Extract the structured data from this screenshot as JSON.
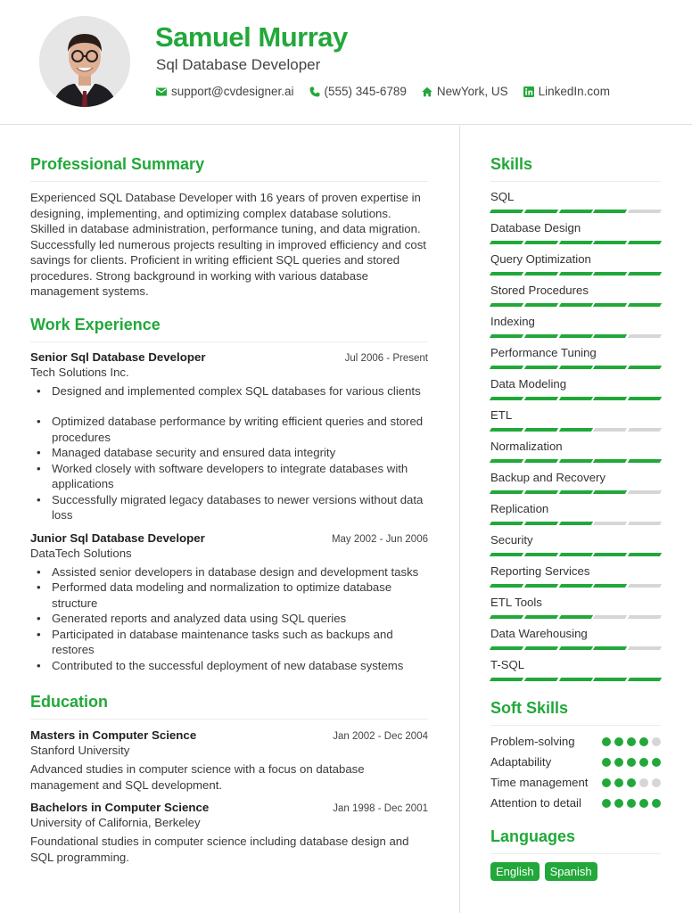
{
  "header": {
    "name": "Samuel Murray",
    "title": "Sql Database Developer",
    "contacts": [
      {
        "icon": "envelope-icon",
        "text": "support@cvdesigner.ai"
      },
      {
        "icon": "phone-icon",
        "text": "(555) 345-6789"
      },
      {
        "icon": "home-icon",
        "text": "NewYork, US"
      },
      {
        "icon": "linkedin-icon",
        "text": "LinkedIn.com"
      }
    ]
  },
  "colors": {
    "accent": "#22a83a",
    "inactive": "#d6d6d6"
  },
  "summary": {
    "heading": "Professional Summary",
    "text": "Experienced SQL Database Developer with 16 years of proven expertise in designing, implementing, and optimizing complex database solutions. Skilled in database administration, performance tuning, and data migration. Successfully led numerous projects resulting in improved efficiency and cost savings for clients. Proficient in writing efficient SQL queries and stored procedures. Strong background in working with various database management systems."
  },
  "experience": {
    "heading": "Work Experience",
    "jobs": [
      {
        "title": "Senior Sql Database Developer",
        "date": "Jul 2006 - Present",
        "company": "Tech Solutions Inc.",
        "bullets": [
          "Designed and implemented complex SQL databases for various clients",
          "Optimized database performance by writing efficient queries and stored procedures",
          "Managed database security and ensured data integrity",
          "Worked closely with software developers to integrate databases with applications",
          "Successfully migrated legacy databases to newer versions without data loss"
        ]
      },
      {
        "title": "Junior Sql Database Developer",
        "date": "May 2002 - Jun 2006",
        "company": "DataTech Solutions",
        "bullets": [
          "Assisted senior developers in database design and development tasks",
          "Performed data modeling and normalization to optimize database structure",
          "Generated reports and analyzed data using SQL queries",
          "Participated in database maintenance tasks such as backups and restores",
          "Contributed to the successful deployment of new database systems"
        ]
      }
    ]
  },
  "education": {
    "heading": "Education",
    "items": [
      {
        "degree": "Masters in Computer Science",
        "date": "Jan 2002 - Dec 2004",
        "school": "Stanford University",
        "desc": "Advanced studies in computer science with a focus on database management and SQL development."
      },
      {
        "degree": "Bachelors in Computer Science",
        "date": "Jan 1998 - Dec 2001",
        "school": "University of California, Berkeley",
        "desc": "Foundational studies in computer science including database design and SQL programming."
      }
    ]
  },
  "skills": {
    "heading": "Skills",
    "max": 5,
    "items": [
      {
        "name": "SQL",
        "level": 4
      },
      {
        "name": "Database Design",
        "level": 5
      },
      {
        "name": "Query Optimization",
        "level": 5
      },
      {
        "name": "Stored Procedures",
        "level": 5
      },
      {
        "name": "Indexing",
        "level": 4
      },
      {
        "name": "Performance Tuning",
        "level": 5
      },
      {
        "name": "Data Modeling",
        "level": 5
      },
      {
        "name": "ETL",
        "level": 3
      },
      {
        "name": "Normalization",
        "level": 5
      },
      {
        "name": "Backup and Recovery",
        "level": 4
      },
      {
        "name": "Replication",
        "level": 3
      },
      {
        "name": "Security",
        "level": 5
      },
      {
        "name": "Reporting Services",
        "level": 4
      },
      {
        "name": "ETL Tools",
        "level": 3
      },
      {
        "name": "Data Warehousing",
        "level": 4
      },
      {
        "name": "T-SQL",
        "level": 5
      }
    ]
  },
  "soft_skills": {
    "heading": "Soft Skills",
    "max": 5,
    "items": [
      {
        "name": "Problem-solving",
        "level": 4
      },
      {
        "name": "Adaptability",
        "level": 5
      },
      {
        "name": "Time management",
        "level": 3
      },
      {
        "name": "Attention to detail",
        "level": 5
      }
    ]
  },
  "languages": {
    "heading": "Languages",
    "items": [
      "English",
      "Spanish"
    ]
  }
}
